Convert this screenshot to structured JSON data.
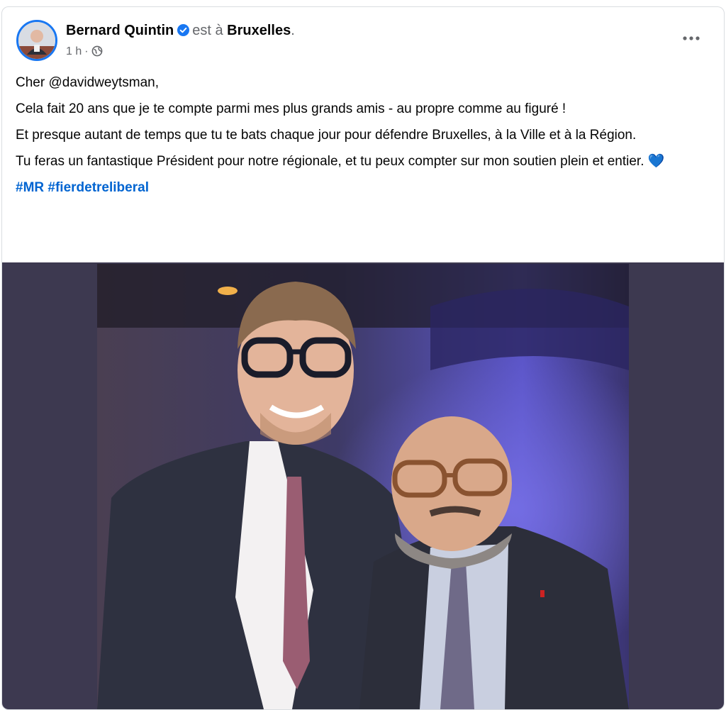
{
  "post": {
    "author": "Bernard Quintin",
    "location_prefix": "est à",
    "location": "Bruxelles",
    "location_suffix": ".",
    "timestamp": "1 h",
    "audience_icon": "globe-icon",
    "more_icon": "more-horizontal-icon",
    "verified_icon": "verified-badge-icon",
    "paragraphs": [
      "Cher @davidweytsman,",
      "Cela fait 20 ans que je te compte parmi mes plus grands amis - au propre comme au figuré !",
      "Et presque autant de temps que tu te bats chaque jour pour défendre Bruxelles, à la Ville et à la Région.",
      "Tu feras un fantastique Président pour notre régionale, et tu peux compter sur mon soutien plein et entier."
    ],
    "emoji": "💙",
    "hashtags": [
      "#MR",
      "#fierdetreliberal"
    ]
  },
  "colors": {
    "link_blue": "#0064d1",
    "verified_blue": "#1877f2",
    "text": "#050505",
    "secondary": "#65676b",
    "photo_letterbox": "#3d3950"
  }
}
